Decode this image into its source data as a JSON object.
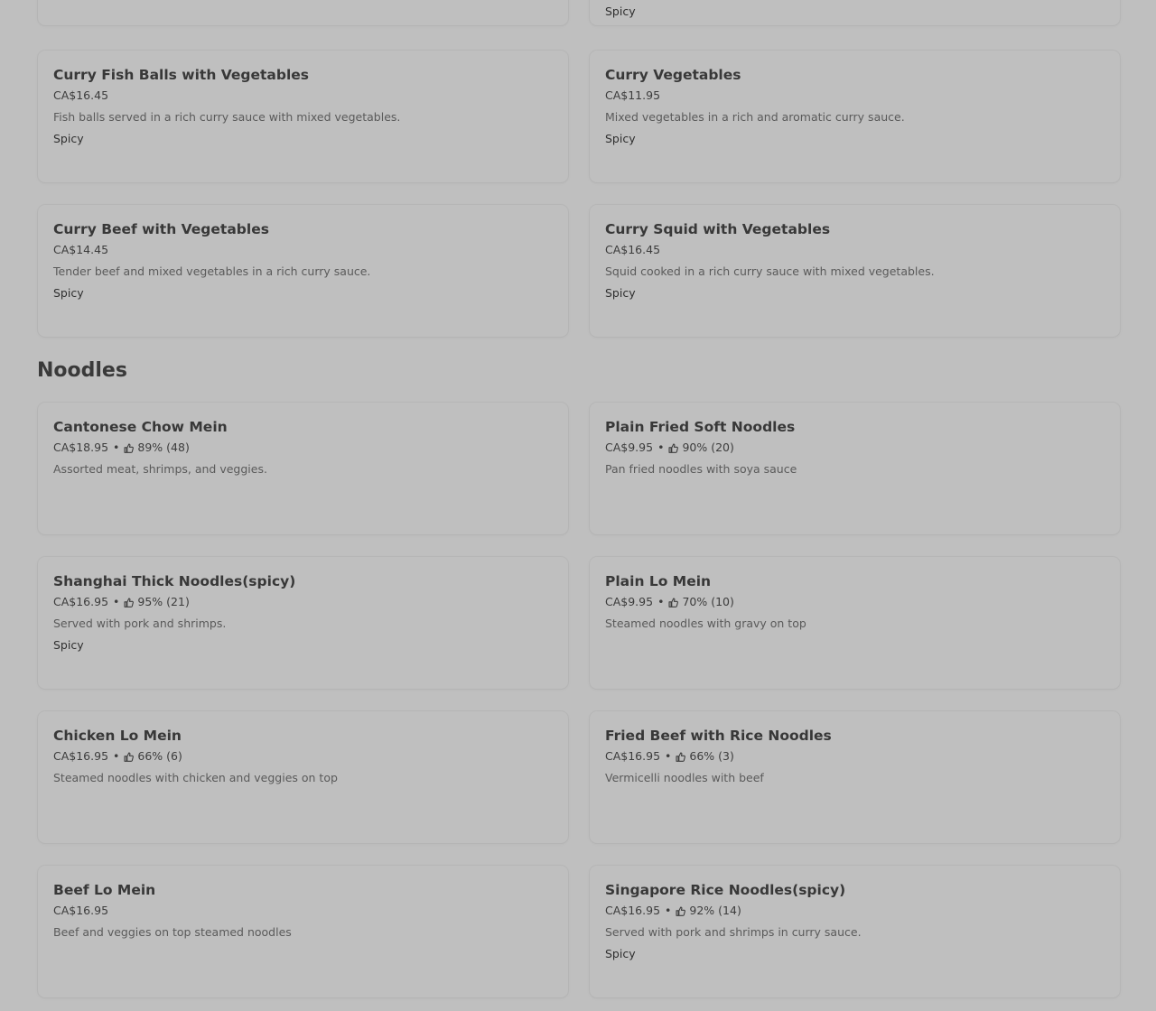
{
  "top_partial": {
    "right_tag": "Spicy"
  },
  "section_curry_items": [
    {
      "name": "Curry Fish Balls with Vegetables",
      "price": "CA$16.45",
      "description": "Fish balls served in a rich curry sauce with mixed vegetables.",
      "tag": "Spicy"
    },
    {
      "name": "Curry Vegetables",
      "price": "CA$11.95",
      "description": "Mixed vegetables in a rich and aromatic curry sauce.",
      "tag": "Spicy"
    },
    {
      "name": "Curry Beef with Vegetables",
      "price": "CA$14.45",
      "description": "Tender beef and mixed vegetables in a rich curry sauce.",
      "tag": "Spicy"
    },
    {
      "name": "Curry Squid with Vegetables",
      "price": "CA$16.45",
      "description": "Squid cooked in a rich curry sauce with mixed vegetables.",
      "tag": "Spicy"
    }
  ],
  "noodles": {
    "title": "Noodles",
    "items": [
      {
        "name": "Cantonese Chow Mein",
        "price": "CA$18.95",
        "rating": "89% (48)",
        "description": "Assorted meat, shrimps, and veggies.",
        "tag": ""
      },
      {
        "name": "Plain Fried Soft Noodles",
        "price": "CA$9.95",
        "rating": "90% (20)",
        "description": "Pan fried noodles with soya sauce",
        "tag": ""
      },
      {
        "name": "Shanghai Thick Noodles(spicy)",
        "price": "CA$16.95",
        "rating": "95% (21)",
        "description": "Served with pork and shrimps.",
        "tag": "Spicy"
      },
      {
        "name": "Plain Lo Mein",
        "price": "CA$9.95",
        "rating": "70% (10)",
        "description": "Steamed noodles with gravy on top",
        "tag": ""
      },
      {
        "name": "Chicken Lo Mein",
        "price": "CA$16.95",
        "rating": "66% (6)",
        "description": "Steamed noodles with chicken and veggies on top",
        "tag": ""
      },
      {
        "name": "Fried Beef with Rice Noodles",
        "price": "CA$16.95",
        "rating": "66% (3)",
        "description": "Vermicelli noodles with beef",
        "tag": ""
      },
      {
        "name": "Beef Lo Mein",
        "price": "CA$16.95",
        "rating": "",
        "description": "Beef and veggies on top steamed noodles",
        "tag": ""
      },
      {
        "name": "Singapore Rice Noodles(spicy)",
        "price": "CA$16.95",
        "rating": "92% (14)",
        "description": "Served with pork and shrimps in curry sauce.",
        "tag": "Spicy"
      }
    ]
  },
  "separator": "•",
  "icons": {
    "rating": "thumbs-up-icon"
  }
}
